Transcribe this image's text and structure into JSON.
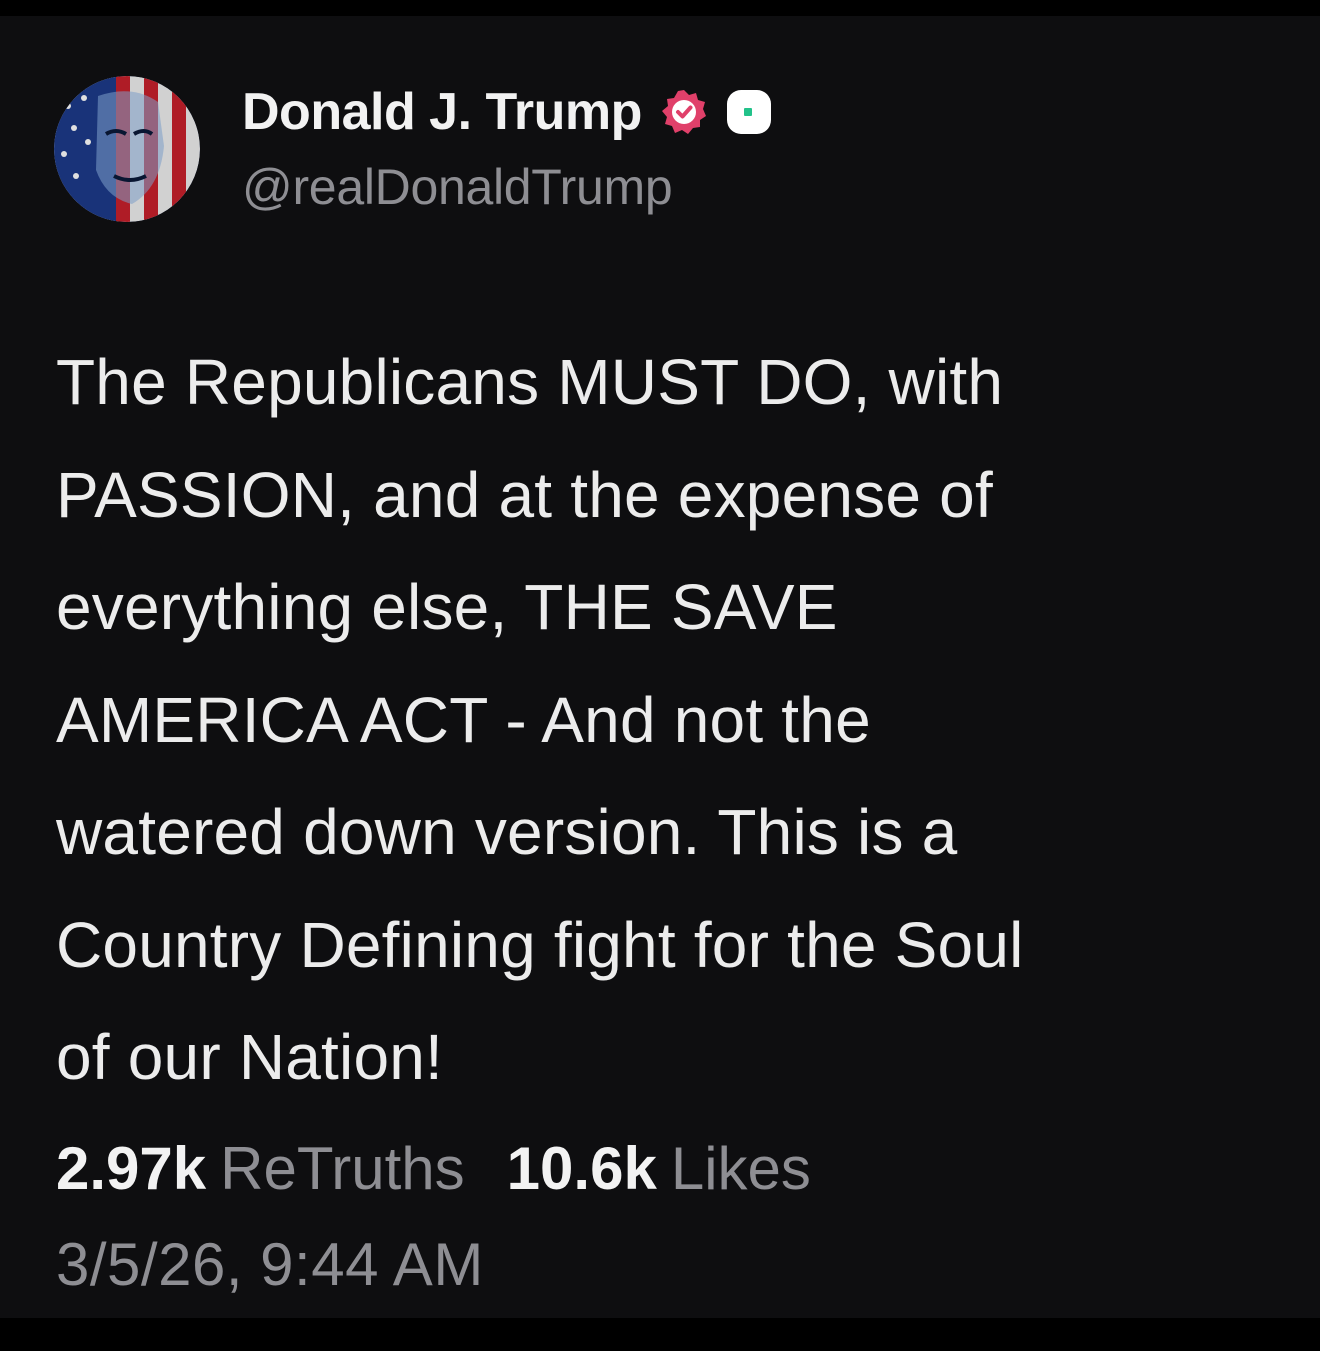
{
  "post": {
    "author": {
      "display_name": "Donald J. Trump",
      "handle": "@realDonaldTrump",
      "avatar_icon": "profile-avatar-flag-portrait",
      "verified_icon": "verified-badge-icon",
      "status_icon": "status-badge-icon"
    },
    "text": "The Republicans MUST DO, with\nPASSION, and at the expense of\neverything else, THE SAVE\nAMERICA ACT - And not the\nwatered down version. This is a\nCountry Defining fight for the Soul\nof our Nation!",
    "stats": {
      "retruths_count": "2.97k",
      "retruths_label": "ReTruths",
      "likes_count": "10.6k",
      "likes_label": "Likes"
    },
    "timestamp": "3/5/26, 9:44 AM"
  },
  "colors": {
    "background": "#0e0e10",
    "primary_text": "#ececec",
    "secondary_text": "#8e8e93",
    "verified_badge": "#e0406a",
    "status_accent": "#22c28a"
  }
}
